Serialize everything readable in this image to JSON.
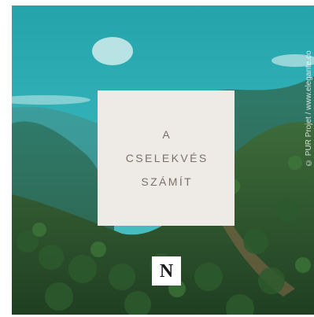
{
  "card": {
    "line1": "A",
    "line2": "CSELEKVÉS",
    "line3": "SZÁMÍT"
  },
  "logo": {
    "letter": "N",
    "icon": "nespresso-logo-icon"
  },
  "credit": {
    "text": "© PUR Projet / www.elegante.co"
  },
  "colors": {
    "card_background": "#eeebe7",
    "card_text": "#7b7068",
    "sky": "#2fb0b6",
    "forest": "#2f5a34"
  }
}
